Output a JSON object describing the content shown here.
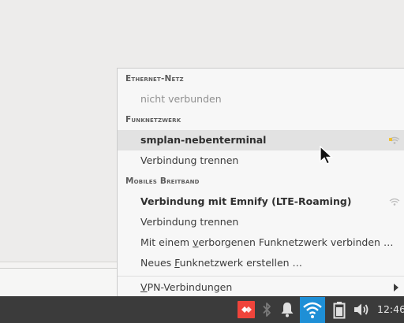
{
  "network_menu": {
    "sections": {
      "ethernet": "Ethernet-Netz",
      "wifi": "Funknetzwerk",
      "mobile": "Mobiles Breitband"
    },
    "ethernet_status": "nicht verbunden",
    "wifi_network": "smplan-nebenterminal",
    "wifi_disconnect": "Verbindung trennen",
    "mobile_network": "Verbindung mit Emnify (LTE-Roaming)",
    "mobile_disconnect": "Verbindung trennen",
    "hidden_network": {
      "before": "Mit einem ",
      "mnemonic": "v",
      "after": "erborgenen Funknetzwerk verbinden …"
    },
    "new_network": {
      "before": "Neues ",
      "mnemonic": "F",
      "after": "unknetzwerk erstellen …"
    },
    "vpn": {
      "before": "",
      "mnemonic": "V",
      "after": "PN-Verbindungen"
    }
  },
  "taskbar": {
    "clock": "12:46",
    "icons": [
      "anydesk-icon",
      "bluetooth-icon",
      "notification-bell-icon",
      "wifi-icon",
      "battery-icon",
      "volume-icon"
    ],
    "colors": {
      "anydesk": "#ef443b",
      "active_tray": "#1e8fd6"
    }
  }
}
